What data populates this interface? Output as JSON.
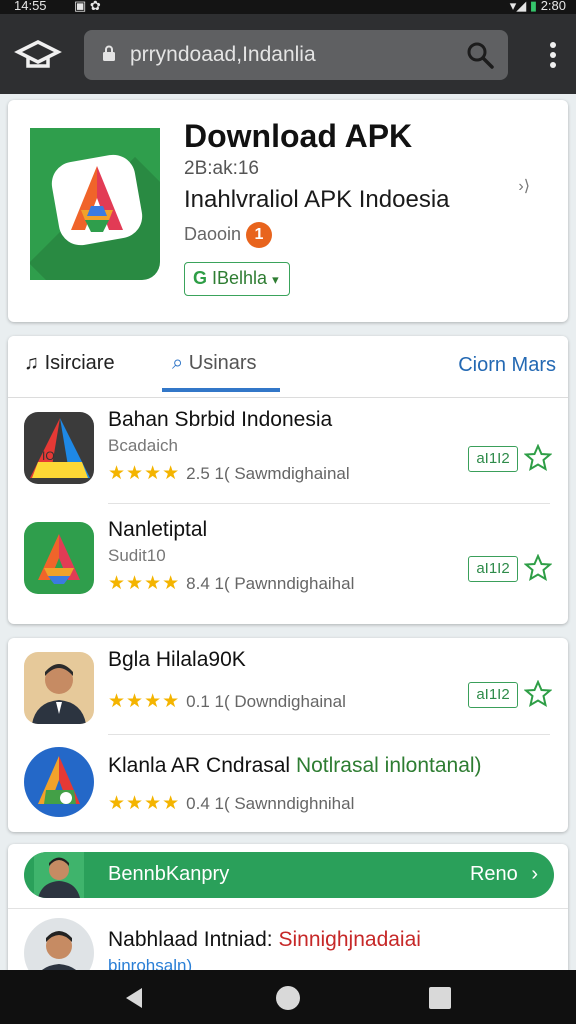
{
  "status_bar": {
    "time": "14:55",
    "right_text": "2:80"
  },
  "browser": {
    "url": "prryndoaad,Indanlia",
    "search_icon": "search-icon",
    "menu_icon": "more-vert-icon"
  },
  "app_header": {
    "title": "Download APK",
    "version": "2B:ak:16",
    "subtitle": "Inahlvraliol APK Indoesia",
    "meta_label": "Daooin",
    "meta_badge": "1",
    "chip_label": "IBelhla",
    "chip_icon": "G",
    "colors": {
      "icon_bg": "#2f9e4c",
      "badge": "#e8641d",
      "chip": "#3aa35b"
    }
  },
  "tabs": [
    {
      "label": "Isirciare",
      "icon": "music-note-icon"
    },
    {
      "label": "Usinars",
      "icon": "people-icon",
      "active": true
    },
    {
      "label": "Ciorn Mars"
    }
  ],
  "apps": [
    {
      "name": "Bahan Sbrbid Indonesia",
      "sub": "Bcadaich",
      "stars": "★★★★",
      "rating": "2.5 1( Sawmdighainal",
      "button": "aI1I2",
      "icon_label": "IO"
    },
    {
      "name": "Nanletiptal",
      "sub": "Sudit10",
      "stars": "★★★★",
      "rating": "8.4 1( Pawnndighaihal",
      "button": "aI1I2"
    }
  ],
  "people": [
    {
      "name": "Bgla Hilala90K",
      "stars": "★★★★",
      "rating": "0.1 1( Downdighainal",
      "button": "aI1I2"
    },
    {
      "name": "Klanla AR Cndrasal",
      "name_extra": "Notlrasal inlontanal)",
      "stars": "★★★★",
      "rating": "0.4 1( Sawnndighnihal"
    }
  ],
  "promo": {
    "text": "BennbKanpry",
    "action": "Reno",
    "color": "#2aa05a"
  },
  "bottom_item": {
    "name": "Nabhlaad Intniad:",
    "name_red": "Sinnighjnadaiai",
    "sub": "binrohsaln)"
  }
}
